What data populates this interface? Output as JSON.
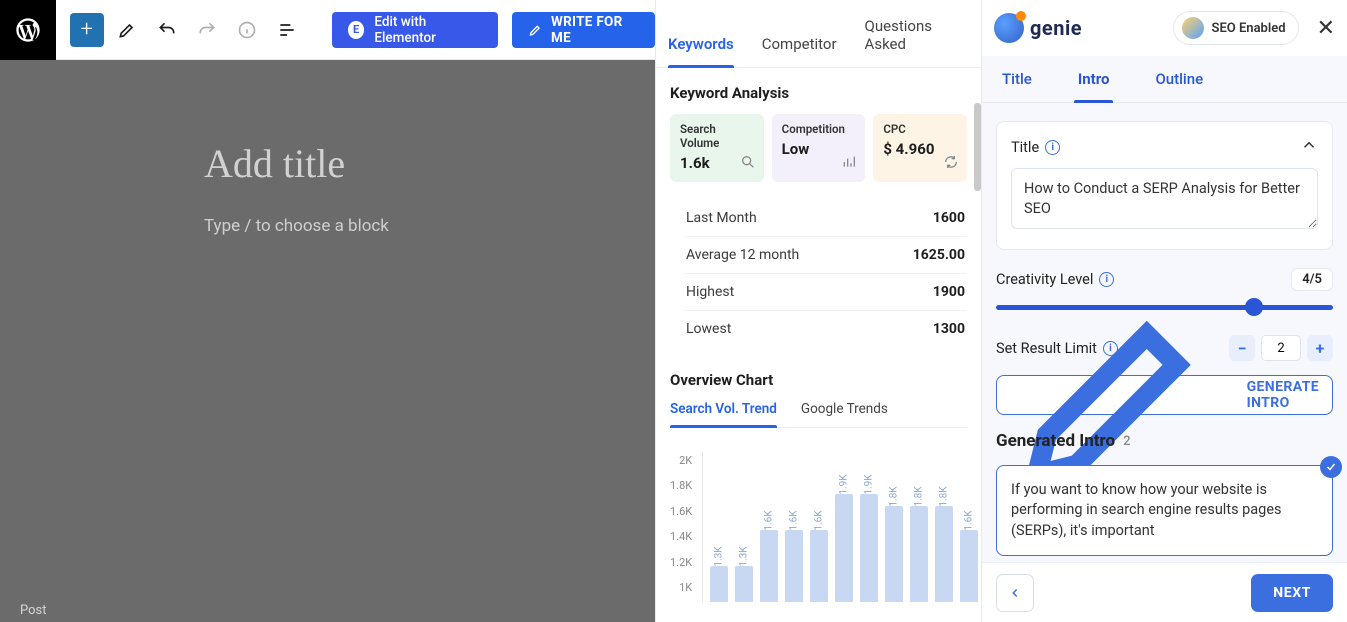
{
  "wp": {
    "title_placeholder": "Add title",
    "slash_prompt": "Type / to choose a block",
    "footer": "Post",
    "elementor_label": "Edit with Elementor",
    "write_label": "WRITE FOR ME"
  },
  "mid": {
    "tabs": {
      "keywords": "Keywords",
      "competitor": "Competitor",
      "questions": "Questions Asked"
    },
    "analysis_title": "Keyword Analysis",
    "stats": {
      "search_volume": {
        "label": "Search Volume",
        "value": "1.6k"
      },
      "competition": {
        "label": "Competition",
        "value": "Low"
      },
      "cpc": {
        "label": "CPC",
        "value": "$ 4.960"
      }
    },
    "metrics": {
      "last_month": {
        "label": "Last Month",
        "value": "1600"
      },
      "avg12": {
        "label": "Average 12 month",
        "value": "1625.00"
      },
      "highest": {
        "label": "Highest",
        "value": "1900"
      },
      "lowest": {
        "label": "Lowest",
        "value": "1300"
      }
    },
    "overview_title": "Overview Chart",
    "chart_tabs": {
      "sv": "Search Vol. Trend",
      "gt": "Google Trends"
    },
    "y_ticks": [
      "2K",
      "1.8K",
      "1.6K",
      "1.4K",
      "1.2K",
      "1K"
    ]
  },
  "chart_data": {
    "type": "bar",
    "ylabel": "Search Volume",
    "ylim": [
      1000,
      2000
    ],
    "bar_labels": [
      "1.3K",
      "1.3K",
      "1.6K",
      "1.6K",
      "1.6K",
      "1.9K",
      "1.9K",
      "1.8K",
      "1.8K",
      "1.8K",
      "1.6K"
    ],
    "values": [
      1300,
      1300,
      1600,
      1600,
      1600,
      1900,
      1900,
      1800,
      1800,
      1800,
      1600
    ]
  },
  "right": {
    "brand": "genie",
    "seo_label": "SEO Enabled",
    "tabs": {
      "title": "Title",
      "intro": "Intro",
      "outline": "Outline"
    },
    "title_card": {
      "label": "Title",
      "value": "How to Conduct a SERP Analysis for Better SEO"
    },
    "creativity": {
      "label": "Creativity Level",
      "value": "4/5"
    },
    "result_limit": {
      "label": "Set Result Limit",
      "value": "2"
    },
    "generate_btn": "GENERATE INTRO",
    "generated": {
      "heading": "Generated Intro",
      "count": "2",
      "text": "If you want to know how your website is performing in search engine results pages (SERPs), it's important"
    },
    "back": "‹",
    "next": "NEXT"
  }
}
